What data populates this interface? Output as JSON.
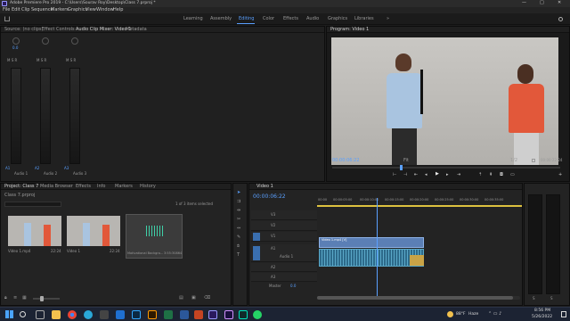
{
  "window": {
    "title": "Adobe Premiere Pro 2019 - C:\\Users\\Sourav Roy\\Desktop\\Class 7.prproj *",
    "controls": [
      "—",
      "□",
      "✕"
    ]
  },
  "menu": [
    "File",
    "Edit",
    "Clip",
    "Sequence",
    "Markers",
    "Graphics",
    "View",
    "Window",
    "Help"
  ],
  "workspaces": {
    "items": [
      "Learning",
      "Assembly",
      "Editing",
      "Color",
      "Effects",
      "Audio",
      "Graphics",
      "Libraries"
    ],
    "active": "Editing",
    "more": "»"
  },
  "source_panel": {
    "tabs": [
      "Source: (no clips)",
      "Effect Controls",
      "Audio Clip Mixer: Video 1",
      "Metadata"
    ],
    "active_tab": "Audio Clip Mixer: Video 1",
    "channels": [
      {
        "label": "Audio 1",
        "code": "A1",
        "pan": "0.0"
      },
      {
        "label": "Audio 2",
        "code": "A2",
        "pan": "0.0"
      },
      {
        "label": "Audio 3",
        "code": "A3",
        "pan": "0.0"
      }
    ],
    "scale": [
      "0",
      "-6",
      "-12",
      "-18",
      "-24",
      "-30",
      "-36",
      "-42",
      "-48",
      "-54",
      "dB"
    ]
  },
  "program_panel": {
    "tab": "Program: Video 1",
    "timecode": "00:00:06:22",
    "fit": "Fit",
    "quality": "1/2",
    "duration": "00:00:22:24"
  },
  "project_panel": {
    "tabs": [
      "Project: Class 7",
      "Media Browser",
      "Effects",
      "Info",
      "Markers",
      "History"
    ],
    "active_tab": "Project: Class 7",
    "project_file": "Class 7.prproj",
    "selection_info": "1 of 3 items selected",
    "search_placeholder": "",
    "items": [
      {
        "name": "Video 1.mp4",
        "duration": "22:24",
        "kind": "video"
      },
      {
        "name": "Video 1",
        "duration": "22:24",
        "kind": "sequence"
      },
      {
        "name": "Motivational Backgro...",
        "duration": "3:55:30864",
        "kind": "audio"
      }
    ]
  },
  "timeline": {
    "tab": "Video 1",
    "timecode": "00:00:06:22",
    "ruler": [
      "00:00",
      "00:00:05:00",
      "00:00:10:00",
      "00:00:15:00",
      "00:00:20:00",
      "00:00:25:00",
      "00:00:30:00",
      "00:00:35:00"
    ],
    "video_tracks": [
      "V3",
      "V2",
      "V1"
    ],
    "audio_tracks": [
      "A1",
      "A2",
      "A3"
    ],
    "v1_clip": "Video 1.mp4 [V]",
    "a1_label": "Audio 1",
    "master": "Master",
    "master_value": "0.0",
    "playhead_fraction": 0.29
  },
  "audio_meter": {
    "labels": [
      "S",
      "S"
    ]
  },
  "taskbar": {
    "weather_temp": "88°F",
    "weather_text": "Haze",
    "time": "8:56 PM",
    "date": "5/26/2022"
  }
}
